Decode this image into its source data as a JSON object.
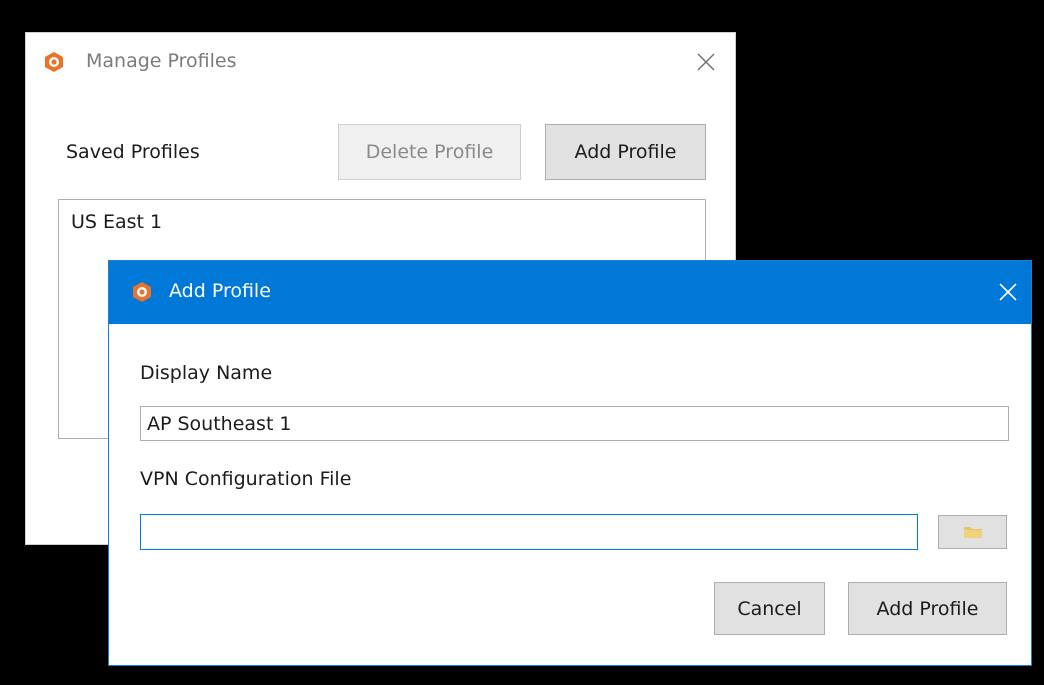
{
  "manage_window": {
    "title": "Manage Profiles",
    "saved_profiles_label": "Saved Profiles",
    "delete_button": "Delete Profile",
    "add_button": "Add Profile",
    "profiles": [
      "US East 1"
    ]
  },
  "add_dialog": {
    "title": "Add Profile",
    "display_name_label": "Display Name",
    "display_name_value": "AP Southeast 1",
    "config_file_label": "VPN Configuration File",
    "config_file_value": "",
    "cancel_button": "Cancel",
    "add_button": "Add Profile"
  },
  "colors": {
    "accent": "#0078d7",
    "logo": "#e8742a",
    "folder": "#e8c466"
  },
  "icons": {
    "app_logo": "app-logo-icon",
    "close": "close-icon",
    "browse": "folder-icon"
  }
}
